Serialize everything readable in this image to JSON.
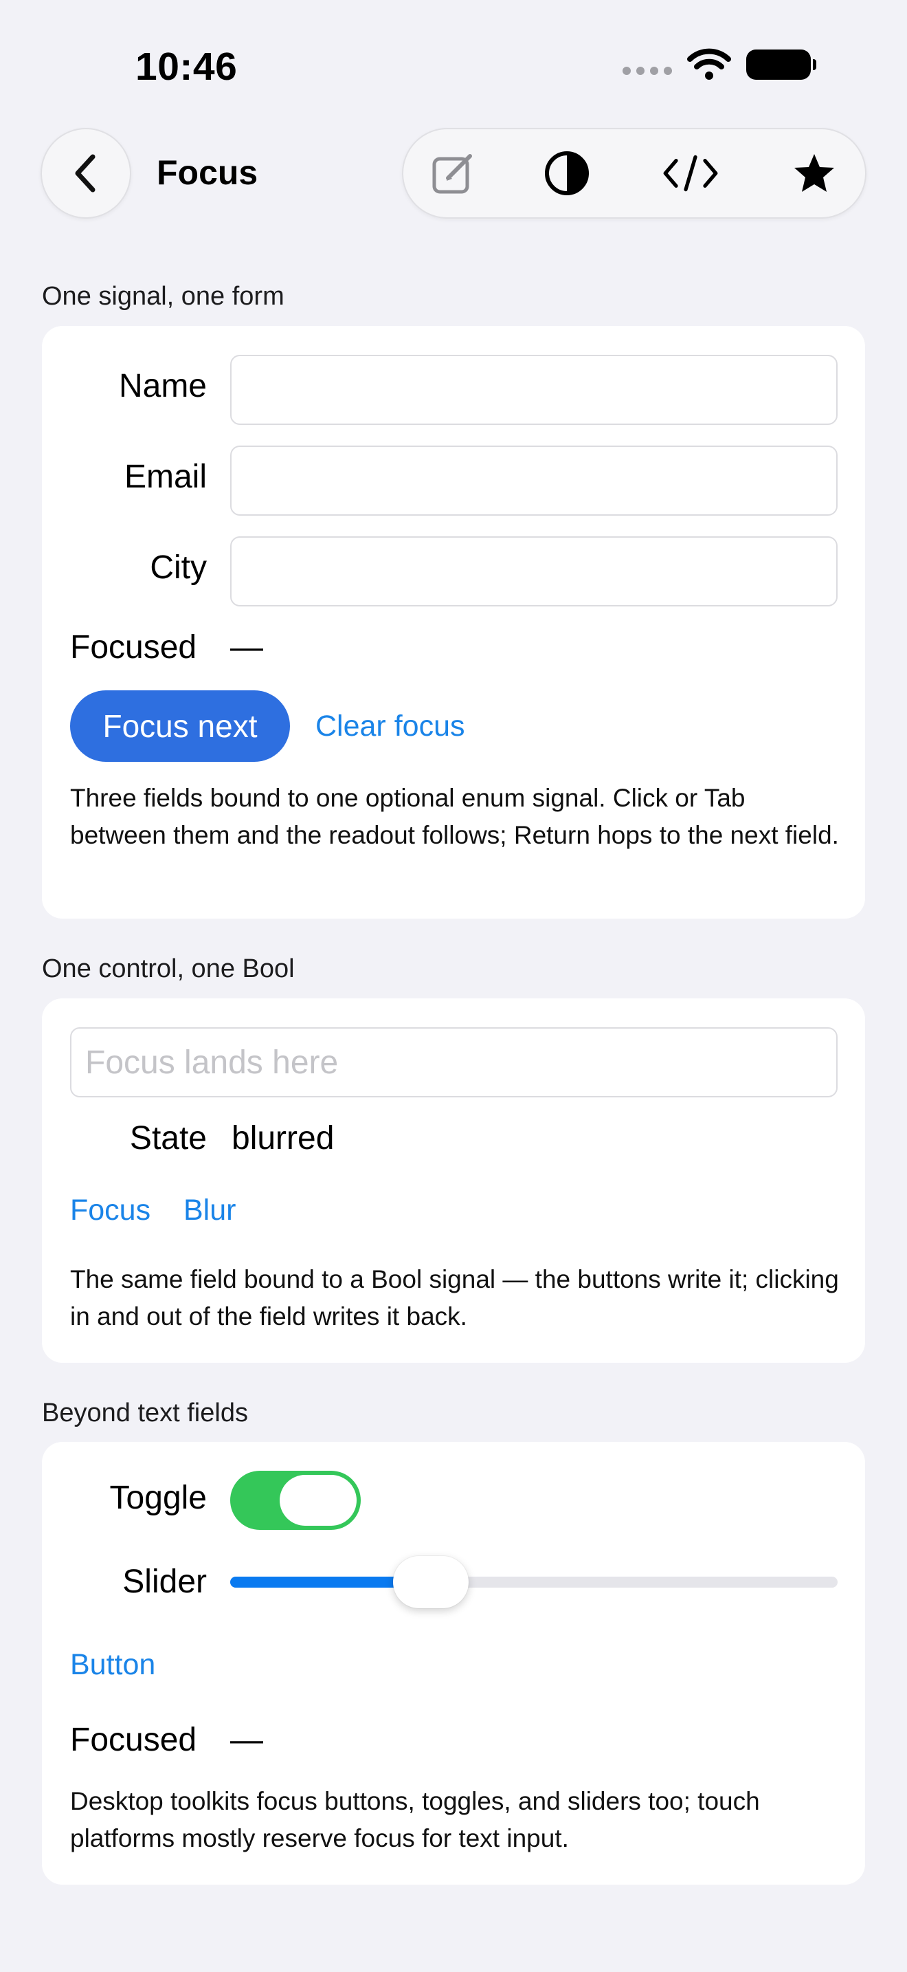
{
  "status_bar": {
    "time": "10:46"
  },
  "nav": {
    "title": "Focus"
  },
  "toolbar": {
    "icons": [
      "compose-icon",
      "contrast-icon",
      "code-icon",
      "star-icon"
    ]
  },
  "sections": {
    "form": {
      "label": "One signal, one form",
      "fields": [
        {
          "label": "Name",
          "value": ""
        },
        {
          "label": "Email",
          "value": ""
        },
        {
          "label": "City",
          "value": ""
        }
      ],
      "focused_label": "Focused",
      "focused_value": "—",
      "focus_next": "Focus next",
      "clear_focus": "Clear focus",
      "description": "Three fields bound to one optional enum signal. Click or Tab between them and the readout follows; Return hops to the next field."
    },
    "bool": {
      "label": "One control, one Bool",
      "input_placeholder": "Focus lands here",
      "state_label": "State",
      "state_value": "blurred",
      "focus": "Focus",
      "blur": "Blur",
      "description": "The same field bound to a Bool signal — the buttons write it; clicking in and out of the field writes it back."
    },
    "beyond": {
      "label": "Beyond text fields",
      "toggle_label": "Toggle",
      "toggle_on": true,
      "slider_label": "Slider",
      "slider_value": 0.33,
      "button": "Button",
      "focused_label": "Focused",
      "focused_value": "—",
      "description": "Desktop toolkits focus buttons, toggles, and sliders too; touch platforms mostly reserve focus for text input."
    }
  },
  "colors": {
    "accent": "#1A84E8",
    "primary_button": "#2E6FE0",
    "toggle_on": "#34C759",
    "background": "#F2F2F7"
  }
}
